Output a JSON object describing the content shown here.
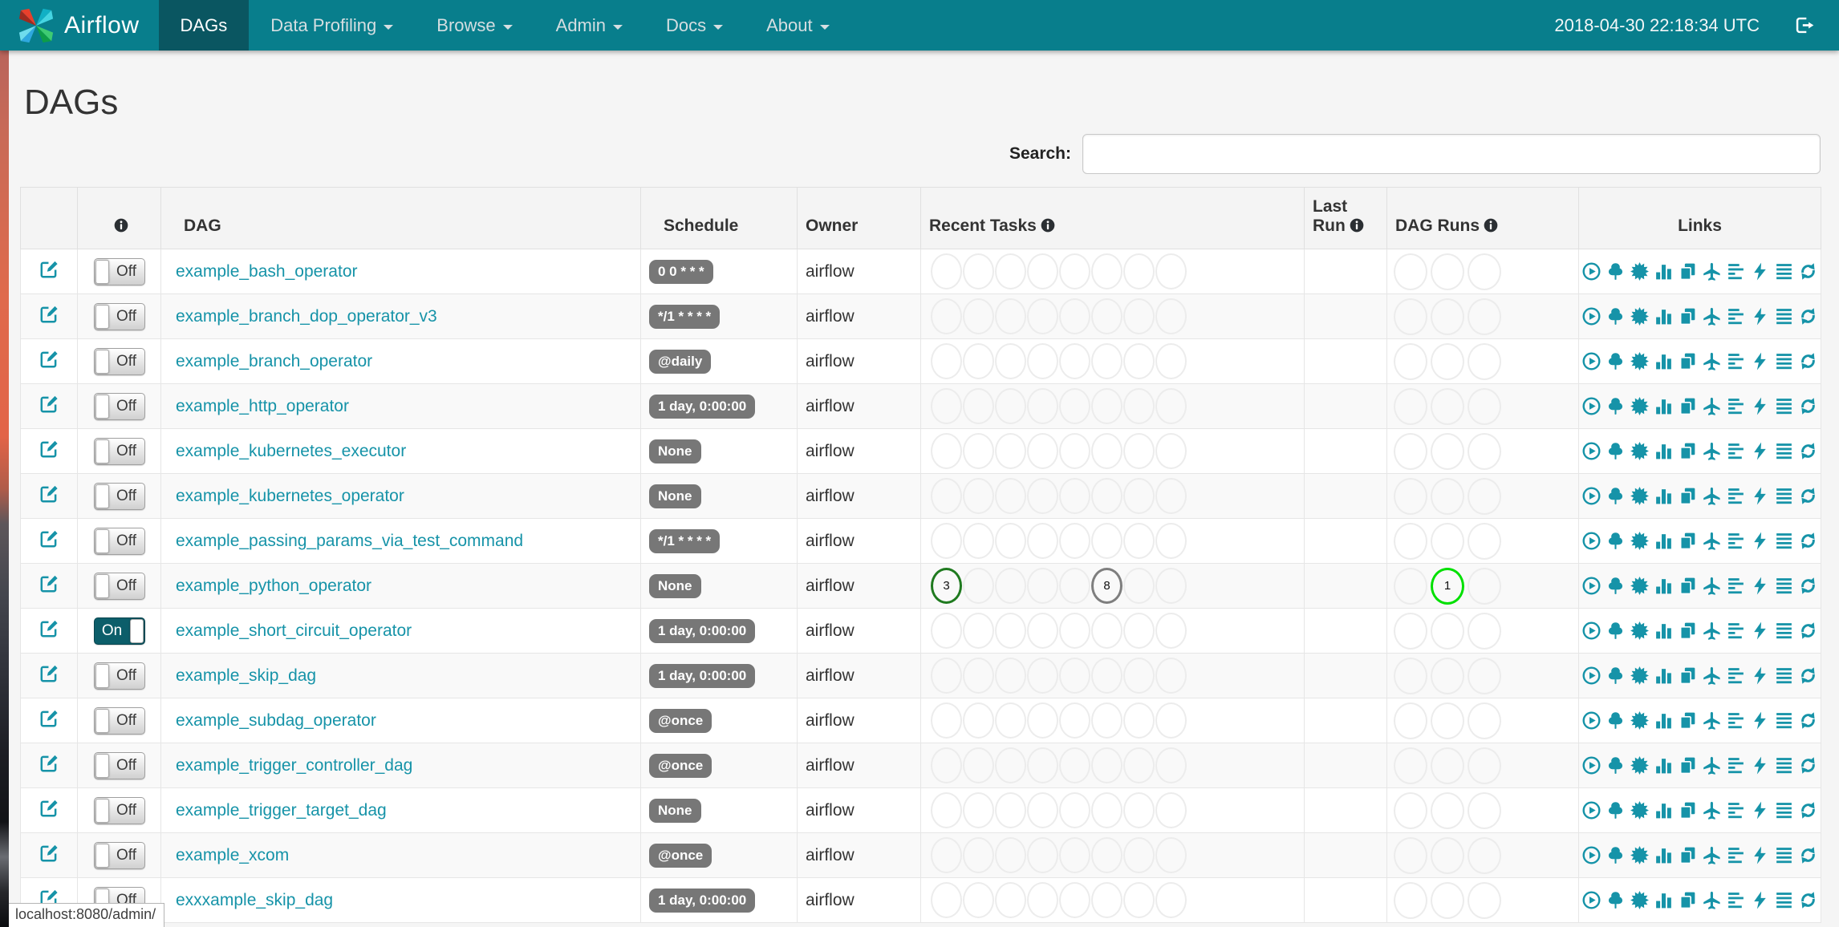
{
  "navbar": {
    "brand": "Airflow",
    "items": [
      {
        "label": "DAGs",
        "active": true,
        "caret": false
      },
      {
        "label": "Data Profiling",
        "active": false,
        "caret": true
      },
      {
        "label": "Browse",
        "active": false,
        "caret": true
      },
      {
        "label": "Admin",
        "active": false,
        "caret": true
      },
      {
        "label": "Docs",
        "active": false,
        "caret": true
      },
      {
        "label": "About",
        "active": false,
        "caret": true
      }
    ],
    "clock": "2018-04-30 22:18:34 UTC",
    "logout_icon": "log-out-icon"
  },
  "page": {
    "title": "DAGs"
  },
  "search": {
    "label": "Search:",
    "value": "",
    "placeholder": ""
  },
  "table": {
    "headers": {
      "edit": "",
      "info": "",
      "dag": "DAG",
      "schedule": "Schedule",
      "owner": "Owner",
      "recent_tasks": "Recent Tasks",
      "last_run": "Last Run",
      "dag_runs": "DAG Runs",
      "links": "Links"
    },
    "recent_task_slots": 8,
    "dag_run_slots": 3,
    "link_icons": [
      "trigger-dag",
      "tree-view",
      "graph-view",
      "task-duration",
      "task-tries",
      "landing-times",
      "gantt-view",
      "code-view",
      "logs",
      "refresh"
    ],
    "rows": [
      {
        "dag_id": "example_bash_operator",
        "toggle": "Off",
        "schedule": "0 0 * * *",
        "owner": "airflow",
        "last_run": "",
        "recent_tasks": [],
        "dag_runs": []
      },
      {
        "dag_id": "example_branch_dop_operator_v3",
        "toggle": "Off",
        "schedule": "*/1 * * * *",
        "owner": "airflow",
        "last_run": "",
        "recent_tasks": [],
        "dag_runs": []
      },
      {
        "dag_id": "example_branch_operator",
        "toggle": "Off",
        "schedule": "@daily",
        "owner": "airflow",
        "last_run": "",
        "recent_tasks": [],
        "dag_runs": []
      },
      {
        "dag_id": "example_http_operator",
        "toggle": "Off",
        "schedule": "1 day, 0:00:00",
        "owner": "airflow",
        "last_run": "",
        "recent_tasks": [],
        "dag_runs": []
      },
      {
        "dag_id": "example_kubernetes_executor",
        "toggle": "Off",
        "schedule": "None",
        "owner": "airflow",
        "last_run": "",
        "recent_tasks": [],
        "dag_runs": []
      },
      {
        "dag_id": "example_kubernetes_operator",
        "toggle": "Off",
        "schedule": "None",
        "owner": "airflow",
        "last_run": "",
        "recent_tasks": [],
        "dag_runs": []
      },
      {
        "dag_id": "example_passing_params_via_test_command",
        "toggle": "Off",
        "schedule": "*/1 * * * *",
        "owner": "airflow",
        "last_run": "",
        "recent_tasks": [],
        "dag_runs": []
      },
      {
        "dag_id": "example_python_operator",
        "toggle": "Off",
        "schedule": "None",
        "owner": "airflow",
        "last_run": "",
        "recent_tasks": [
          {
            "slot": 0,
            "count": "3",
            "state": "success"
          },
          {
            "slot": 5,
            "count": "8",
            "state": "queued"
          }
        ],
        "dag_runs": [
          {
            "slot": 1,
            "count": "1",
            "state": "running"
          }
        ]
      },
      {
        "dag_id": "example_short_circuit_operator",
        "toggle": "On",
        "schedule": "1 day, 0:00:00",
        "owner": "airflow",
        "last_run": "",
        "recent_tasks": [],
        "dag_runs": []
      },
      {
        "dag_id": "example_skip_dag",
        "toggle": "Off",
        "schedule": "1 day, 0:00:00",
        "owner": "airflow",
        "last_run": "",
        "recent_tasks": [],
        "dag_runs": []
      },
      {
        "dag_id": "example_subdag_operator",
        "toggle": "Off",
        "schedule": "@once",
        "owner": "airflow",
        "last_run": "",
        "recent_tasks": [],
        "dag_runs": []
      },
      {
        "dag_id": "example_trigger_controller_dag",
        "toggle": "Off",
        "schedule": "@once",
        "owner": "airflow",
        "last_run": "",
        "recent_tasks": [],
        "dag_runs": []
      },
      {
        "dag_id": "example_trigger_target_dag",
        "toggle": "Off",
        "schedule": "None",
        "owner": "airflow",
        "last_run": "",
        "recent_tasks": [],
        "dag_runs": []
      },
      {
        "dag_id": "example_xcom",
        "toggle": "Off",
        "schedule": "@once",
        "owner": "airflow",
        "last_run": "",
        "recent_tasks": [],
        "dag_runs": []
      },
      {
        "dag_id": "exxxample_skip_dag",
        "toggle": "Off",
        "schedule": "1 day, 0:00:00",
        "owner": "airflow",
        "last_run": "",
        "recent_tasks": [],
        "dag_runs": []
      }
    ]
  },
  "statusbar": {
    "url": "localhost:8080/admin/"
  },
  "colors": {
    "navbar": "#087E8C",
    "navbar_active": "#0A5661",
    "link": "#1693A8",
    "badge_bg": "#777777",
    "states": {
      "success": "#1F7A1F",
      "queued": "#7E7E7E",
      "running": "#00E000"
    }
  }
}
